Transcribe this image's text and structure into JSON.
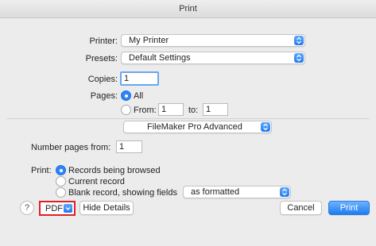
{
  "window": {
    "title": "Print"
  },
  "printer": {
    "label": "Printer:",
    "value": "My Printer"
  },
  "presets": {
    "label": "Presets:",
    "value": "Default Settings"
  },
  "copies": {
    "label": "Copies:",
    "value": "1"
  },
  "pages": {
    "label": "Pages:",
    "all_label": "All",
    "from_label": "From:",
    "from_value": "1",
    "to_label": "to:",
    "to_value": "1",
    "selected": "All"
  },
  "app_menu": {
    "value": "FileMaker Pro Advanced"
  },
  "number_pages": {
    "label": "Number pages from:",
    "value": "1"
  },
  "print_options": {
    "label": "Print:",
    "records_browsed": "Records being browsed",
    "current_record": "Current record",
    "blank_record": "Blank record, showing fields",
    "format_value": "as formatted",
    "selected": "Records being browsed"
  },
  "footer": {
    "help": "?",
    "pdf": "PDF",
    "hide_details": "Hide Details",
    "cancel": "Cancel",
    "print": "Print"
  },
  "colors": {
    "accent": "#2f84f5",
    "highlight_border": "#e02020"
  }
}
